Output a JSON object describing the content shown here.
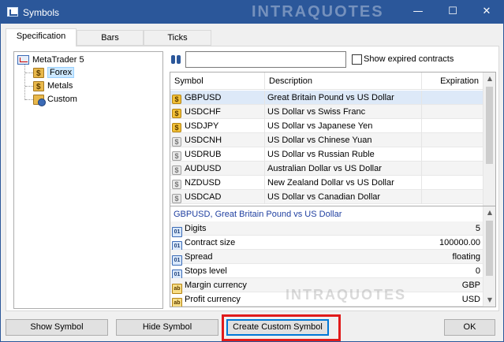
{
  "window": {
    "title": "Symbols",
    "watermark": "INTRAQUOTES",
    "controls": {
      "minimize": "—",
      "maximize": "☐",
      "close": "✕"
    }
  },
  "tabs": [
    {
      "label": "Specification",
      "active": true
    },
    {
      "label": "Bars",
      "active": false
    },
    {
      "label": "Ticks",
      "active": false
    }
  ],
  "tree": {
    "root": "MetaTrader 5",
    "children": [
      {
        "label": "Forex",
        "selected": true,
        "icon": "folder-dollar-icon"
      },
      {
        "label": "Metals",
        "selected": false,
        "icon": "folder-dollar-icon"
      },
      {
        "label": "Custom",
        "selected": false,
        "icon": "folder-gear-icon"
      }
    ]
  },
  "search": {
    "value": "",
    "placeholder": "",
    "show_expired_label": "Show expired contracts",
    "show_expired_checked": false
  },
  "symbols_table": {
    "columns": [
      "Symbol",
      "Description",
      "Expiration"
    ],
    "rows": [
      {
        "symbol": "GBPUSD",
        "description": "Great Britain Pound vs US Dollar",
        "expiration": "",
        "active": true,
        "selected": true
      },
      {
        "symbol": "USDCHF",
        "description": "US Dollar vs Swiss Franc",
        "expiration": "",
        "active": true
      },
      {
        "symbol": "USDJPY",
        "description": "US Dollar vs Japanese Yen",
        "expiration": "",
        "active": true
      },
      {
        "symbol": "USDCNH",
        "description": "US Dollar vs Chinese Yuan",
        "expiration": "",
        "active": false
      },
      {
        "symbol": "USDRUB",
        "description": "US Dollar vs Russian Ruble",
        "expiration": "",
        "active": false
      },
      {
        "symbol": "AUDUSD",
        "description": "Australian Dollar vs US Dollar",
        "expiration": "",
        "active": false
      },
      {
        "symbol": "NZDUSD",
        "description": "New Zealand Dollar vs US Dollar",
        "expiration": "",
        "active": false
      },
      {
        "symbol": "USDCAD",
        "description": "US Dollar vs Canadian Dollar",
        "expiration": "",
        "active": false
      }
    ]
  },
  "properties": {
    "header_symbol": "GBPUSD,",
    "header_description": "Great Britain Pound vs US Dollar",
    "rows": [
      {
        "name": "Digits",
        "value": "5",
        "type": "num"
      },
      {
        "name": "Contract size",
        "value": "100000.00",
        "type": "num"
      },
      {
        "name": "Spread",
        "value": "floating",
        "type": "num"
      },
      {
        "name": "Stops level",
        "value": "0",
        "type": "num"
      },
      {
        "name": "Margin currency",
        "value": "GBP",
        "type": "txt"
      },
      {
        "name": "Profit currency",
        "value": "USD",
        "type": "txt"
      }
    ],
    "num_icon_text": "01",
    "txt_icon_text": "ab",
    "watermark": "INTRAQUOTES"
  },
  "buttons": {
    "show_symbol": "Show Symbol",
    "hide_symbol": "Hide Symbol",
    "create_custom_symbol": "Create Custom Symbol",
    "ok": "OK"
  },
  "colors": {
    "titlebar": "#2b579a",
    "highlight": "#e01b1b",
    "selected_row": "#dde9f8"
  }
}
